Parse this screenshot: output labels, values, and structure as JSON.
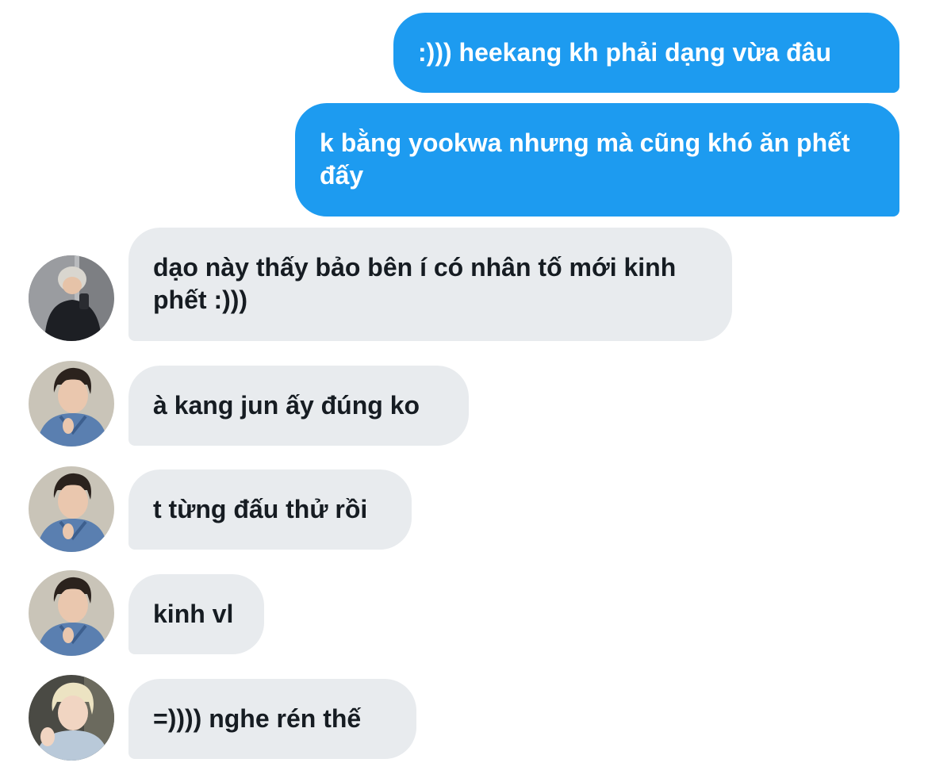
{
  "colors": {
    "outgoing_bubble": "#1d9bf0",
    "incoming_bubble": "#e8ebee",
    "outgoing_text": "#ffffff",
    "incoming_text": "#161c22"
  },
  "messages": [
    {
      "direction": "outgoing",
      "text": ":))) heekang kh phải dạng vừa đâu"
    },
    {
      "direction": "outgoing",
      "text": "k bằng yookwa nhưng mà cũng khó ăn phết đấy"
    },
    {
      "direction": "incoming",
      "text": "dạo này thấy bảo bên í có nhân tố mới kinh phết :)))",
      "avatar": "user-avatar-dark-jacket"
    },
    {
      "direction": "incoming",
      "text": "à kang jun ấy đúng ko",
      "avatar": "user-avatar-denim-jacket"
    },
    {
      "direction": "incoming",
      "text": "t từng đấu thử rồi",
      "avatar": "user-avatar-denim-jacket"
    },
    {
      "direction": "incoming",
      "text": "kinh vl",
      "avatar": "user-avatar-denim-jacket"
    },
    {
      "direction": "incoming",
      "text": "=)))) nghe rén thế",
      "avatar": "user-avatar-blond-hair"
    }
  ]
}
